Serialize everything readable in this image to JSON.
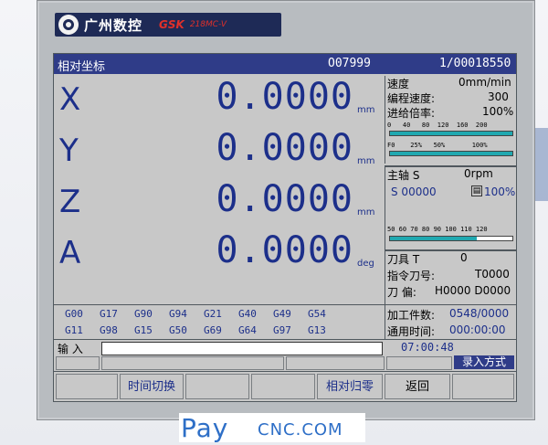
{
  "brand": {
    "name": "广州数控",
    "gsk": "GSK",
    "model": "218MC-V"
  },
  "header": {
    "title": "相对坐标",
    "program": "O07999",
    "block": "1/00018550"
  },
  "axes": [
    {
      "name": "X",
      "value": "0.0000",
      "unit": "mm"
    },
    {
      "name": "Y",
      "value": "0.0000",
      "unit": "mm"
    },
    {
      "name": "Z",
      "value": "0.0000",
      "unit": "mm"
    },
    {
      "name": "A",
      "value": "0.0000",
      "unit": "deg"
    }
  ],
  "feed": {
    "title": "速度",
    "rate": "0mm/min",
    "programmed_label": "编程速度:",
    "programmed_value": "300",
    "override_label": "进给倍率:",
    "override_value": "100%",
    "scale1": "0   40   80  120  160  200",
    "scale2": "F0    25%   50%       100%",
    "override_fraction": 1.0
  },
  "spindle": {
    "title": "主轴 S",
    "rpm": "0rpm",
    "s_label": "S 00000",
    "override": "100%",
    "scale": "50 60 70 80 90 100 110 120",
    "override_fraction": 0.71
  },
  "tool": {
    "title": "刀具 T",
    "value": "0",
    "cmd_label": "指令刀号:",
    "cmd_value": "T0000",
    "offset_label": "刀  偏:",
    "offset_value": "H0000 D0000"
  },
  "gcodes": [
    "G00",
    "G17",
    "G90",
    "G94",
    "G21",
    "G40",
    "G49",
    "G54",
    "G11",
    "G98",
    "G15",
    "G50",
    "G69",
    "G64",
    "G97",
    "G13"
  ],
  "counters": {
    "parts_label": "加工件数:",
    "parts_value": "0548/0000",
    "time_label": "通用时间:",
    "time_value": "000:00:00"
  },
  "input": {
    "label": "输 入",
    "value": ""
  },
  "clock": "07:00:48",
  "mode": "录入方式",
  "softkeys": [
    "",
    "时间切换",
    "",
    "",
    "相对归零",
    "返回",
    ""
  ],
  "colors": {
    "header": "#2f3c88",
    "screen": "#c8c8c8",
    "digits": "#1c2f8a",
    "bar": "#20a8b0"
  },
  "watermark": {
    "pay": "Pay",
    "cnc": "CNC.COM"
  }
}
